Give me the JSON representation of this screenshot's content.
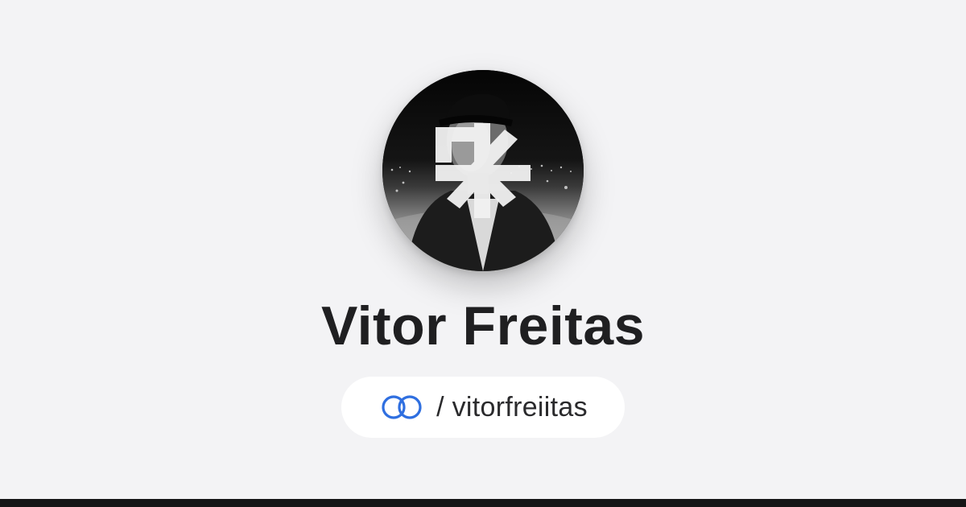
{
  "profile": {
    "name": "Vitor Freitas",
    "handle_separator": "/",
    "handle": "vitorfreiitas",
    "avatar_description_icon": "profile-photo"
  },
  "brand": {
    "logo_icon": "linked-rings-icon",
    "accent": "#2f6fe0"
  },
  "colors": {
    "background": "#f3f3f5",
    "name_text": "#1f1f21",
    "pill_background": "#ffffff",
    "bottom_bar": "#151516"
  }
}
